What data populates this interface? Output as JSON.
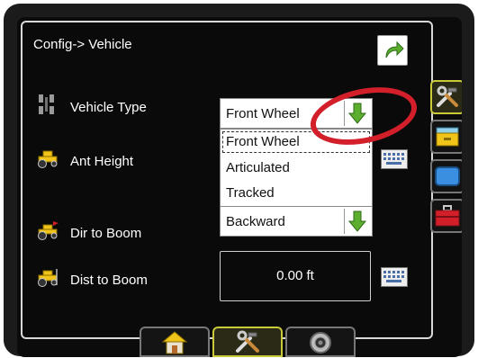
{
  "window": {
    "title": "Config-> Vehicle"
  },
  "buttons": {
    "return_icon": "return-arrow-icon"
  },
  "rows": [
    {
      "label": "Vehicle Type",
      "icon": "vehicle-type-icon"
    },
    {
      "label": "Ant Height",
      "icon": "tractor-icon"
    },
    {
      "label": "Dir to Boom",
      "icon": "tractor-direction-icon"
    },
    {
      "label": "Dist to Boom",
      "icon": "tractor-distance-icon"
    }
  ],
  "vehicle_type": {
    "selected": "Front Wheel",
    "options": [
      "Front Wheel",
      "Articulated",
      "Tracked"
    ],
    "state": "expanded"
  },
  "dir_to_boom": {
    "selected": "Backward"
  },
  "dist_to_boom": {
    "value": "0.00 ft"
  },
  "side_tabs": [
    {
      "name": "tools-tab",
      "icon": "wrench-hammer-icon",
      "active": true
    },
    {
      "name": "data-tab",
      "icon": "drawer-icon",
      "active": false
    },
    {
      "name": "display-tab",
      "icon": "screen-icon",
      "active": false
    },
    {
      "name": "toolbox-tab",
      "icon": "toolbox-icon",
      "active": false
    }
  ],
  "bottom_tabs": [
    {
      "name": "home-tab",
      "icon": "home-icon",
      "active": false
    },
    {
      "name": "tools-tab",
      "icon": "wrench-hammer-icon",
      "active": true
    },
    {
      "name": "camera-tab",
      "icon": "camera-icon",
      "active": false
    }
  ],
  "colors": {
    "accent": "#c9c93a",
    "arrow": "#5cae2e",
    "callout": "#d21f2a"
  }
}
